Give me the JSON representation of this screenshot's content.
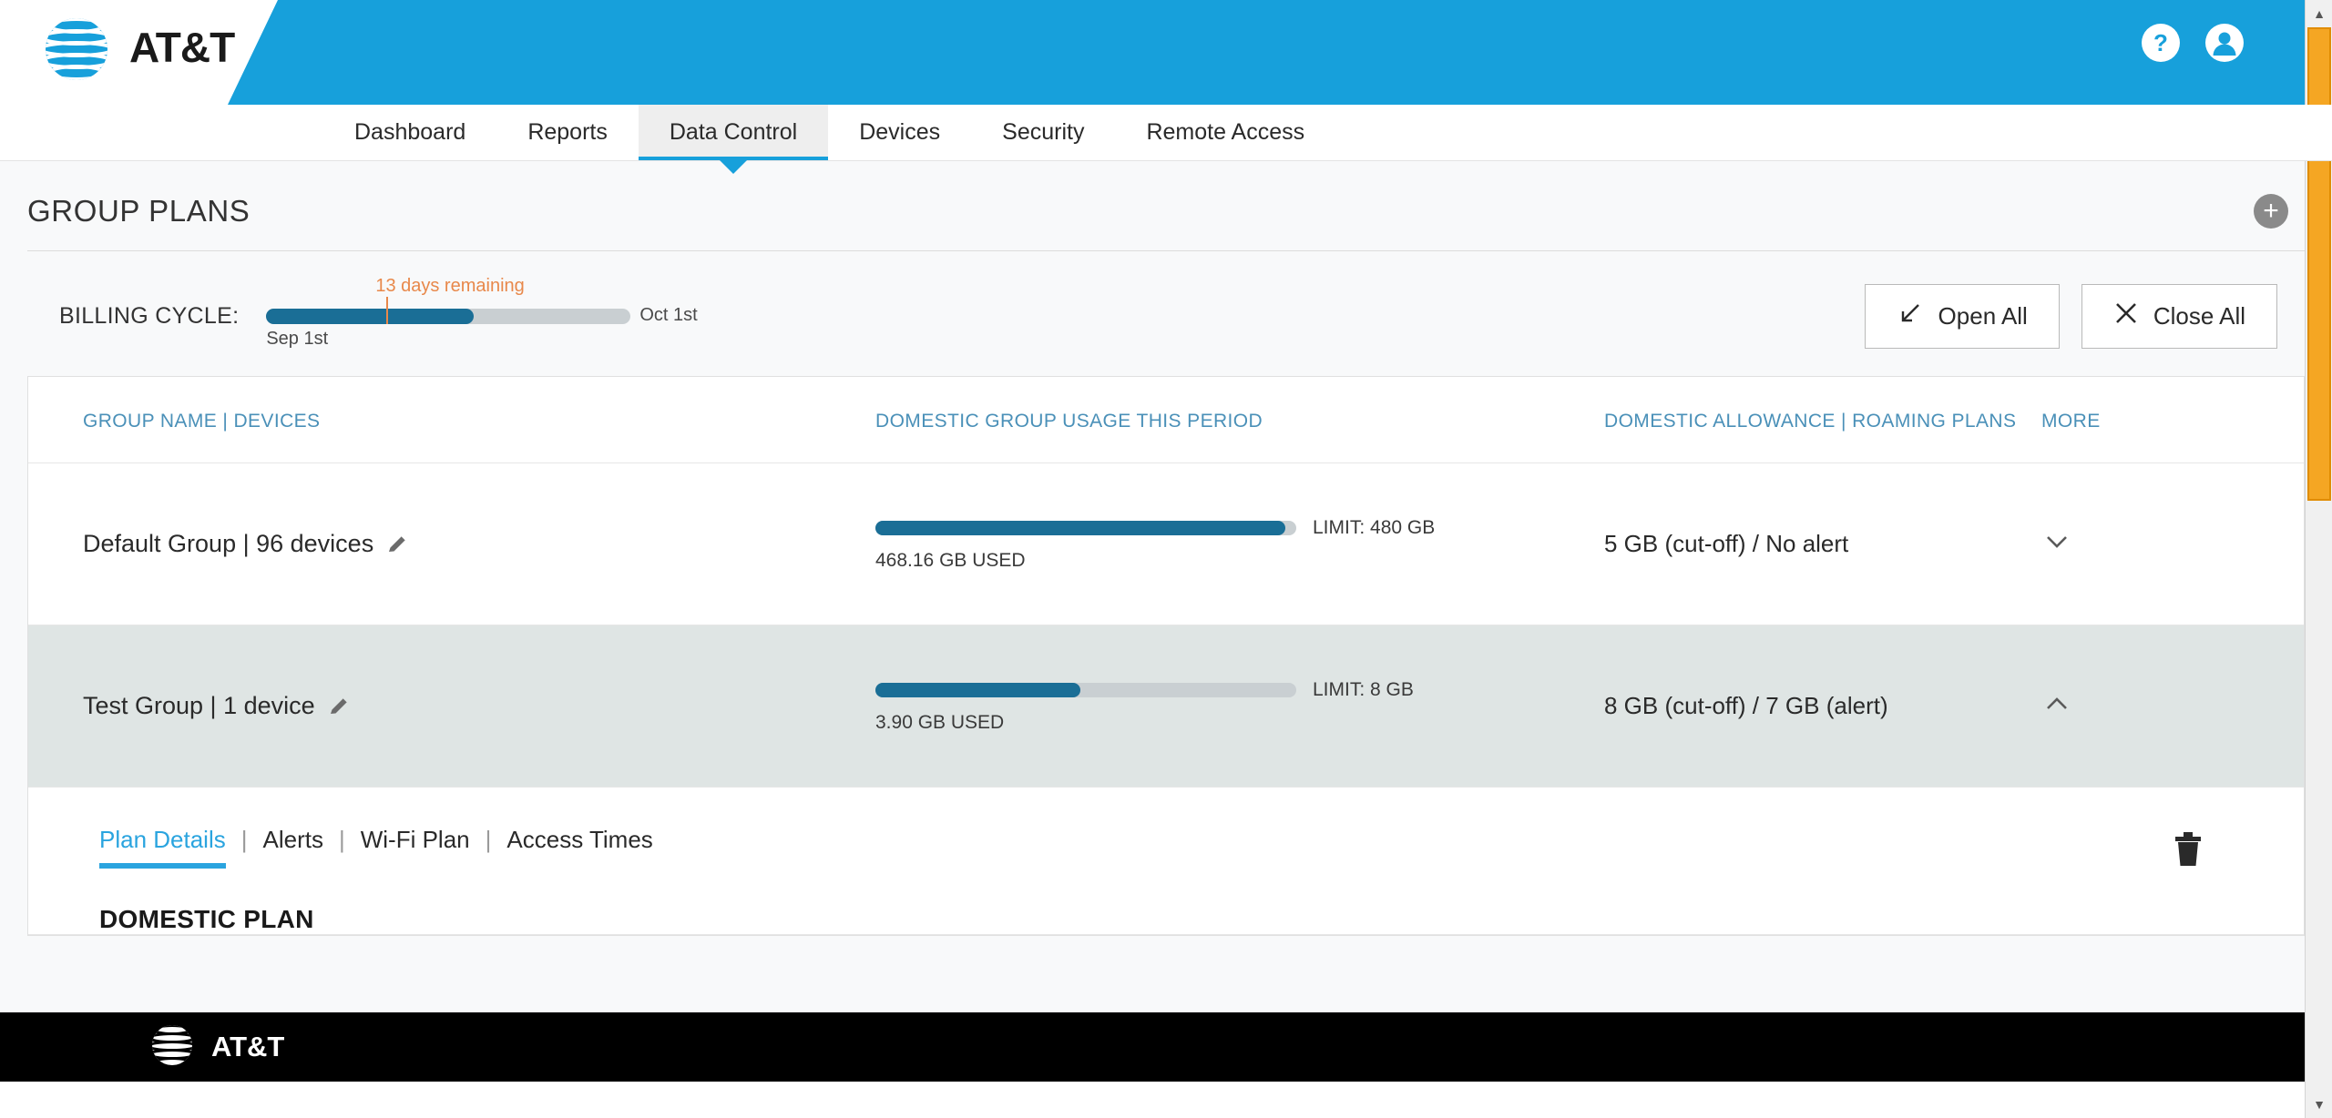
{
  "header": {
    "brand": "AT&T",
    "help_icon": "help-circle-icon",
    "account_icon": "account-circle-icon",
    "brand_color": "#17a0db"
  },
  "nav": {
    "items": [
      {
        "label": "Dashboard",
        "active": false
      },
      {
        "label": "Reports",
        "active": false
      },
      {
        "label": "Data Control",
        "active": true
      },
      {
        "label": "Devices",
        "active": false
      },
      {
        "label": "Security",
        "active": false
      },
      {
        "label": "Remote Access",
        "active": false
      }
    ]
  },
  "page": {
    "title": "GROUP PLANS",
    "add_label": "+"
  },
  "billing": {
    "label": "BILLING CYCLE:",
    "days_remaining": "13 days remaining",
    "start_date": "Sep 1st",
    "end_date": "Oct 1st",
    "progress_percent": 57,
    "marker_percent": 33,
    "fill_color": "#1a6e96",
    "accent_color": "#e8884a"
  },
  "actions": {
    "open_all": "Open All",
    "close_all": "Close All"
  },
  "table": {
    "headers": [
      "GROUP NAME | DEVICES",
      "DOMESTIC GROUP USAGE THIS PERIOD",
      "DOMESTIC ALLOWANCE | ROAMING PLANS",
      "MORE"
    ],
    "rows": [
      {
        "group_name": "Default Group | 96 devices",
        "limit_text": "LIMIT: 480 GB",
        "used_text": "468.16 GB USED",
        "used_percent": 97.5,
        "allowance": "5 GB (cut-off) / No alert",
        "expanded": false,
        "chevron": "chevron-down-icon"
      },
      {
        "group_name": "Test Group | 1 device",
        "limit_text": "LIMIT: 8 GB",
        "used_text": "3.90 GB USED",
        "used_percent": 48.8,
        "allowance": "8 GB (cut-off) / 7 GB (alert)",
        "expanded": true,
        "chevron": "chevron-up-icon"
      }
    ]
  },
  "expanded_panel": {
    "subtabs": [
      {
        "label": "Plan Details",
        "active": true
      },
      {
        "label": "Alerts",
        "active": false
      },
      {
        "label": "Wi-Fi Plan",
        "active": false
      },
      {
        "label": "Access Times",
        "active": false
      }
    ],
    "separator": "|",
    "section_title": "DOMESTIC PLAN",
    "delete_icon": "trash-icon"
  },
  "footer": {
    "brand": "AT&T"
  },
  "scrollbar": {
    "up_arrow": "▲",
    "down_arrow": "▼"
  }
}
